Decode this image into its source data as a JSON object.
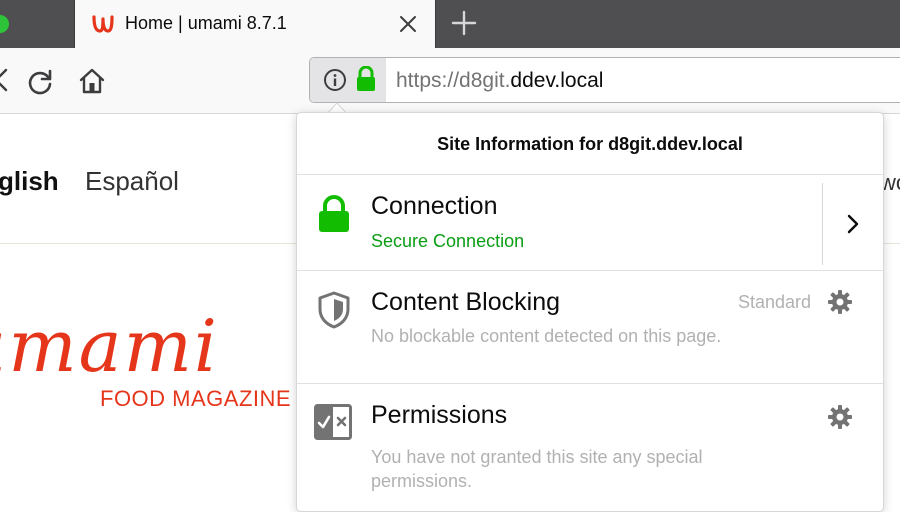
{
  "tab": {
    "title": "Home | umami 8.7.1",
    "favicon": "umami-favicon-icon"
  },
  "urlbar": {
    "scheme": "https://d8git.",
    "host": "ddev.local"
  },
  "page": {
    "languages": [
      "English",
      "Español"
    ],
    "english_visible": "glish",
    "logo_text": "umami",
    "logo_visible": "umami",
    "tagline": "FOOD MAGAZINE",
    "partial_right": "wo"
  },
  "popup": {
    "header": "Site Information for d8git.ddev.local",
    "connection": {
      "title": "Connection",
      "status": "Secure Connection"
    },
    "content_blocking": {
      "title": "Content Blocking",
      "mode": "Standard",
      "detail": "No blockable content detected on this page."
    },
    "permissions": {
      "title": "Permissions",
      "detail": "You have not granted this site any special permissions."
    }
  },
  "colors": {
    "brand": "#e5361b",
    "secure_green": "#12bc00",
    "muted_text": "#b1b1b3",
    "tabstrip": "#4f4f52"
  }
}
